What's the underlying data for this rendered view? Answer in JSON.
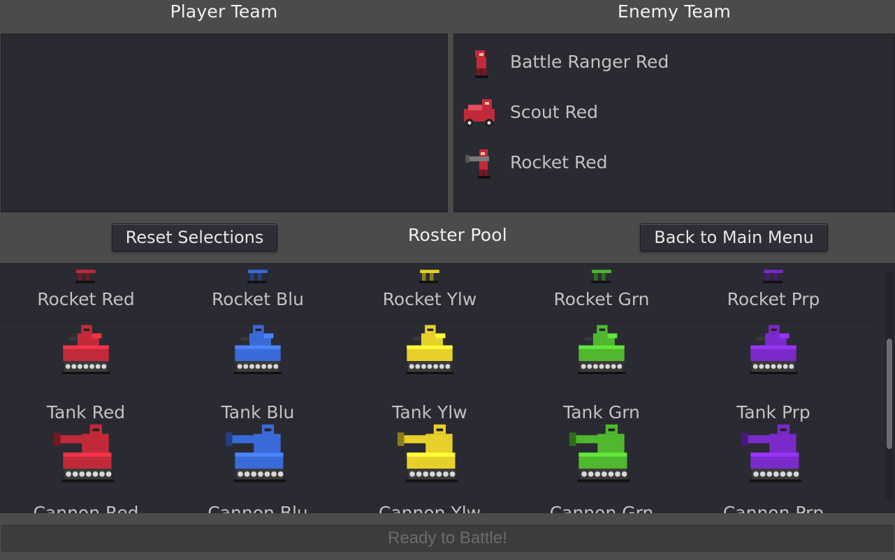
{
  "headers": {
    "player_team": "Player Team",
    "enemy_team": "Enemy Team",
    "roster_pool": "Roster Pool"
  },
  "enemy_team": [
    {
      "name": "Battle Ranger Red",
      "icon": "ranger-sprite-icon",
      "color": "#c22a3a"
    },
    {
      "name": "Scout Red",
      "icon": "scout-car-sprite-icon",
      "color": "#c22a3a"
    },
    {
      "name": "Rocket Red",
      "icon": "rocket-soldier-sprite-icon",
      "color": "#c22a3a"
    }
  ],
  "buttons": {
    "reset": "Reset Selections",
    "back": "Back to Main Menu",
    "ready": "Ready to Battle!"
  },
  "roster": {
    "rows": [
      {
        "unit": "rocket",
        "cells": [
          {
            "label": "Rocket Red",
            "color": "#c22a3a"
          },
          {
            "label": "Rocket Blu",
            "color": "#3a6ad8"
          },
          {
            "label": "Rocket Ylw",
            "color": "#e8d02a"
          },
          {
            "label": "Rocket Grn",
            "color": "#4fb82e"
          },
          {
            "label": "Rocket Prp",
            "color": "#7a2ac8"
          }
        ]
      },
      {
        "unit": "tank",
        "cells": [
          {
            "label": "Tank Red",
            "color": "#c22a3a"
          },
          {
            "label": "Tank Blu",
            "color": "#3a6ad8"
          },
          {
            "label": "Tank Ylw",
            "color": "#e8d02a"
          },
          {
            "label": "Tank Grn",
            "color": "#4fb82e"
          },
          {
            "label": "Tank Prp",
            "color": "#7a2ac8"
          }
        ]
      },
      {
        "unit": "cannon",
        "cells": [
          {
            "label": "Cannon Red",
            "color": "#c22a3a"
          },
          {
            "label": "Cannon Blu",
            "color": "#3a6ad8"
          },
          {
            "label": "Cannon Ylw",
            "color": "#e8d02a"
          },
          {
            "label": "Cannon Grn",
            "color": "#4fb82e"
          },
          {
            "label": "Cannon Prp",
            "color": "#7a2ac8"
          }
        ]
      }
    ]
  }
}
